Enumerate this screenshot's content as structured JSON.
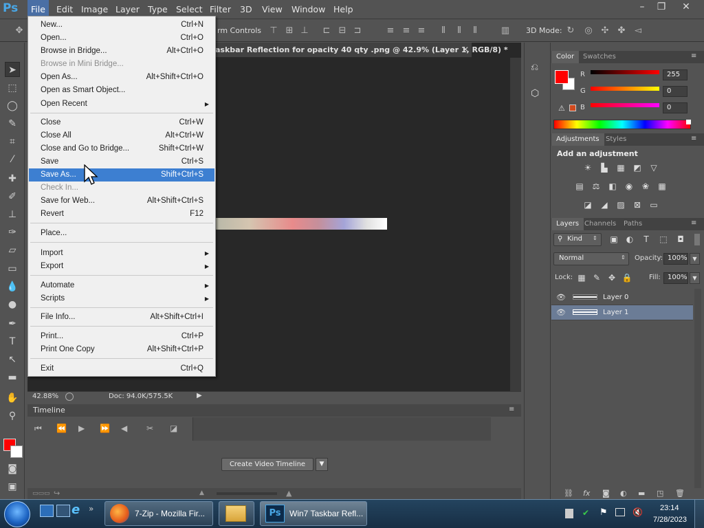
{
  "app": {
    "logo": "Ps"
  },
  "menubar": {
    "items": [
      "File",
      "Edit",
      "Image",
      "Layer",
      "Type",
      "Select",
      "Filter",
      "3D",
      "View",
      "Window",
      "Help"
    ],
    "window_buttons": [
      "–",
      "❐",
      "✕"
    ]
  },
  "options_bar": {
    "transform_controls": "rm Controls",
    "mode_3d": "3D Mode:"
  },
  "document": {
    "tab_title": "askbar Reflection for opacity 40 qty .png @ 42.9% (Layer 1, RGB/8) *",
    "zoom": "42.88%",
    "doc_size": "Doc: 94.0K/575.5K"
  },
  "file_menu": {
    "items": [
      {
        "label": "New...",
        "shortcut": "Ctrl+N"
      },
      {
        "label": "Open...",
        "shortcut": "Ctrl+O"
      },
      {
        "label": "Browse in Bridge...",
        "shortcut": "Alt+Ctrl+O"
      },
      {
        "label": "Browse in Mini Bridge...",
        "shortcut": ""
      },
      {
        "label": "Open As...",
        "shortcut": "Alt+Shift+Ctrl+O"
      },
      {
        "label": "Open as Smart Object...",
        "shortcut": ""
      },
      {
        "label": "Open Recent",
        "shortcut": ""
      },
      {
        "label": "Close",
        "shortcut": "Ctrl+W"
      },
      {
        "label": "Close All",
        "shortcut": "Alt+Ctrl+W"
      },
      {
        "label": "Close and Go to Bridge...",
        "shortcut": "Shift+Ctrl+W"
      },
      {
        "label": "Save",
        "shortcut": "Ctrl+S"
      },
      {
        "label": "Save As...",
        "shortcut": "Shift+Ctrl+S"
      },
      {
        "label": "Check In...",
        "shortcut": ""
      },
      {
        "label": "Save for Web...",
        "shortcut": "Alt+Shift+Ctrl+S"
      },
      {
        "label": "Revert",
        "shortcut": "F12"
      },
      {
        "label": "Place...",
        "shortcut": ""
      },
      {
        "label": "Import",
        "shortcut": ""
      },
      {
        "label": "Export",
        "shortcut": ""
      },
      {
        "label": "Automate",
        "shortcut": ""
      },
      {
        "label": "Scripts",
        "shortcut": ""
      },
      {
        "label": "File Info...",
        "shortcut": "Alt+Shift+Ctrl+I"
      },
      {
        "label": "Print...",
        "shortcut": "Ctrl+P"
      },
      {
        "label": "Print One Copy",
        "shortcut": "Alt+Shift+Ctrl+P"
      },
      {
        "label": "Exit",
        "shortcut": "Ctrl+Q"
      }
    ],
    "highlighted": "Save As...",
    "disabled": [
      "Browse in Mini Bridge...",
      "Check In..."
    ],
    "submenus": [
      "Open Recent",
      "Import",
      "Export",
      "Automate",
      "Scripts"
    ]
  },
  "timeline": {
    "title": "Timeline",
    "create_button": "Create Video Timeline"
  },
  "color_panel": {
    "tabs": [
      "Color",
      "Swatches"
    ],
    "r_label": "R",
    "g_label": "G",
    "b_label": "B",
    "r_value": "255",
    "g_value": "0",
    "b_value": "0",
    "foreground": "#ff0000"
  },
  "adjustments_panel": {
    "tabs": [
      "Adjustments",
      "Styles"
    ],
    "heading": "Add an adjustment"
  },
  "layers_panel": {
    "tabs": [
      "Layers",
      "Channels",
      "Paths"
    ],
    "filter": "Kind",
    "blend_mode": "Normal",
    "opacity_label": "Opacity:",
    "opacity_value": "100%",
    "lock_label": "Lock:",
    "fill_label": "Fill:",
    "fill_value": "100%",
    "layers": [
      {
        "name": "Layer 0",
        "selected": false
      },
      {
        "name": "Layer 1",
        "selected": true
      }
    ]
  },
  "taskbar": {
    "tasks": [
      "7-Zip - Mozilla Fir...",
      "Win7 Taskbar Refl..."
    ],
    "time": "23:14",
    "date": "7/28/2023"
  }
}
